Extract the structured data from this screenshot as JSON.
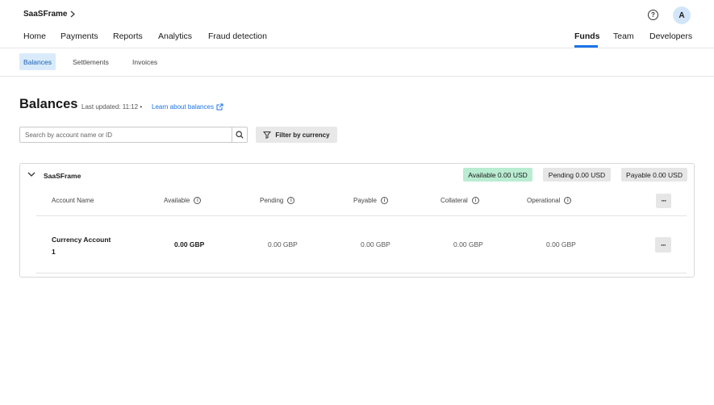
{
  "header": {
    "org_name": "SaaSFrame",
    "avatar_initial": "A",
    "help_glyph": "?"
  },
  "nav": {
    "left": [
      "Home",
      "Payments",
      "Reports",
      "Analytics",
      "Fraud detection"
    ],
    "right": [
      "Funds",
      "Team",
      "Developers"
    ],
    "active": "Funds"
  },
  "subnav": {
    "tabs": [
      "Balances",
      "Settlements",
      "Invoices"
    ],
    "active": "Balances"
  },
  "page": {
    "title": "Balances",
    "last_updated": "Last updated: 11:12 •",
    "learn_link": "Learn about balances"
  },
  "search": {
    "placeholder": "Search by account name or ID"
  },
  "filter": {
    "label": "Filter by currency"
  },
  "card": {
    "title": "SaaSFrame",
    "badges": {
      "available": "Available 0.00 USD",
      "pending": "Pending 0.00 USD",
      "payable": "Payable 0.00 USD"
    },
    "columns": [
      "Account Name",
      "Available",
      "Pending",
      "Payable",
      "Collateral",
      "Operational"
    ],
    "rows": [
      {
        "account_name": "Currency Account 1",
        "available": "0.00 GBP",
        "pending": "0.00 GBP",
        "payable": "0.00 GBP",
        "collateral": "0.00 GBP",
        "operational": "0.00 GBP"
      }
    ],
    "more_glyph": "···"
  },
  "colors": {
    "accent": "#1a73e8",
    "available_badge": "#b9ecd1",
    "active_subtab": "#d9ebfb"
  }
}
